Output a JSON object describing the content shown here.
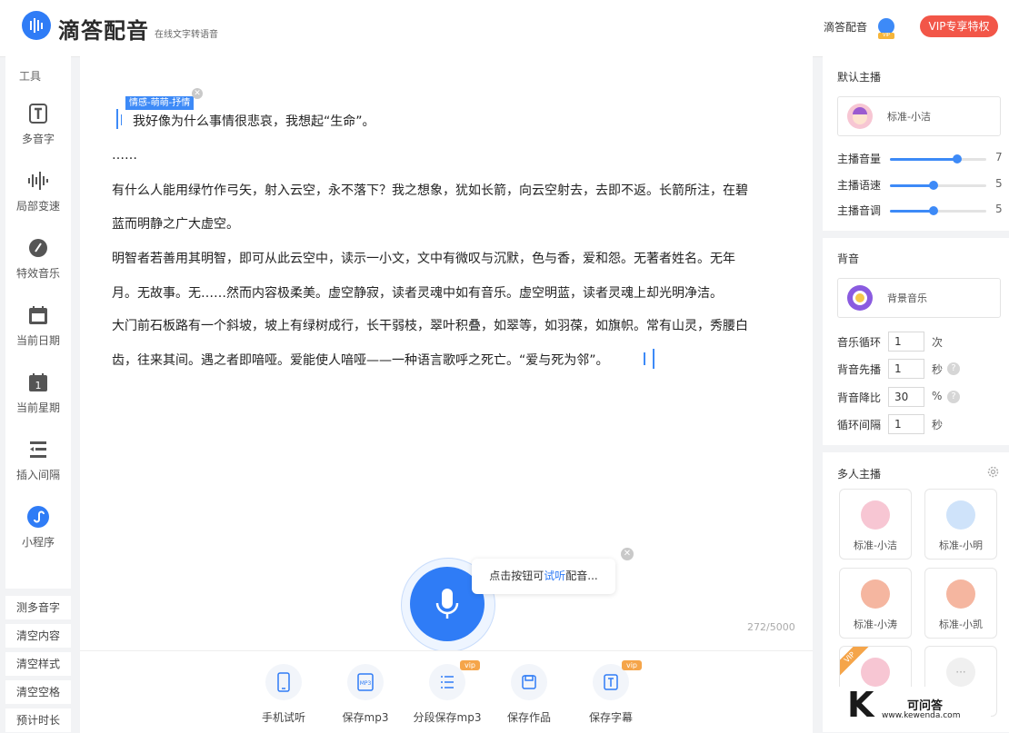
{
  "header": {
    "title": "滴答配音",
    "subtitle": "在线文字转语音",
    "user_label": "滴答配音",
    "vip_badge_text": "VIP",
    "vip_button": "VIP专享特权"
  },
  "tools": {
    "label": "工具",
    "items": [
      {
        "label": "多音字",
        "icon": "polyphone-icon"
      },
      {
        "label": "局部变速",
        "icon": "waveform-icon"
      },
      {
        "label": "特效音乐",
        "icon": "music-effect-icon"
      },
      {
        "label": "当前日期",
        "icon": "calendar-icon"
      },
      {
        "label": "当前星期",
        "icon": "calendar-week-icon"
      },
      {
        "label": "插入间隔",
        "icon": "insert-gap-icon"
      },
      {
        "label": "小程序",
        "icon": "mini-program-icon"
      }
    ],
    "side_buttons": [
      "测多音字",
      "清空内容",
      "清空样式",
      "清空空格",
      "预计时长"
    ]
  },
  "editor": {
    "tag": "情感-萌萌-抒情",
    "paragraphs": [
      "我好像为什么事情很悲哀，我想起“生命”。",
      "……",
      "有什么人能用绿竹作弓矢，射入云空，永不落下？我之想象，犹如长箭，向云空射去，去即不返。长箭所注，在碧",
      "蓝而明静之广大虚空。",
      "明智者若善用其明智，即可从此云空中，读示一小文，文中有微叹与沉默，色与香，爱和怨。无著者姓名。无年",
      "月。无故事。无……然而内容极柔美。虚空静寂，读者灵魂中如有音乐。虚空明蓝，读者灵魂上却光明净洁。",
      "大门前石板路有一个斜坡，坡上有绿树成行，长干弱枝，翠叶积叠，如翠等，如羽葆，如旗帜。常有山灵，秀腰白",
      "齿，往来其间。遇之者即喑哑。爱能使人喑哑——一种语言歌呼之死亡。“爱与死为邻”。"
    ],
    "counter": "272/5000"
  },
  "hint": {
    "prefix": "点击按钮可",
    "link": "试听",
    "suffix": "配音..."
  },
  "bottom_bar": {
    "items": [
      {
        "label": "手机试听",
        "icon": "phone-icon",
        "vip": false
      },
      {
        "label": "保存mp3",
        "icon": "mp3-icon",
        "vip": false
      },
      {
        "label": "分段保存mp3",
        "icon": "list-icon",
        "vip": true
      },
      {
        "label": "保存作品",
        "icon": "save-icon",
        "vip": false
      },
      {
        "label": "保存字幕",
        "icon": "subtitle-icon",
        "vip": true
      }
    ],
    "vip_label": "vip"
  },
  "default_anchor": {
    "title": "默认主播",
    "voice": "标准-小洁",
    "sliders": [
      {
        "label": "主播音量",
        "value": "7",
        "fraction": 0.7
      },
      {
        "label": "主播语速",
        "value": "5",
        "fraction": 0.45
      },
      {
        "label": "主播音调",
        "value": "5",
        "fraction": 0.45
      }
    ]
  },
  "background_music": {
    "title": "背音",
    "track": "背景音乐",
    "settings": [
      {
        "label": "音乐循环",
        "value": "1",
        "unit": "次",
        "help": false
      },
      {
        "label": "背音先播",
        "value": "1",
        "unit": "秒",
        "help": true
      },
      {
        "label": "背音降比",
        "value": "30",
        "unit": "%",
        "help": true
      },
      {
        "label": "循环间隔",
        "value": "1",
        "unit": "秒",
        "help": false
      }
    ]
  },
  "multi_anchor": {
    "title": "多人主播",
    "anchors": [
      "标准-小洁",
      "标准-小明",
      "标准-小涛",
      "标准-小凯"
    ],
    "vip_tag": "VIP",
    "more": "···"
  },
  "watermark": {
    "big_letter": "K",
    "name": "可问答",
    "url": "www.kewenda.com"
  },
  "colors": {
    "accent": "#2f7cf6",
    "vip_red": "#f25648",
    "vip_orange": "#f5a54a"
  }
}
